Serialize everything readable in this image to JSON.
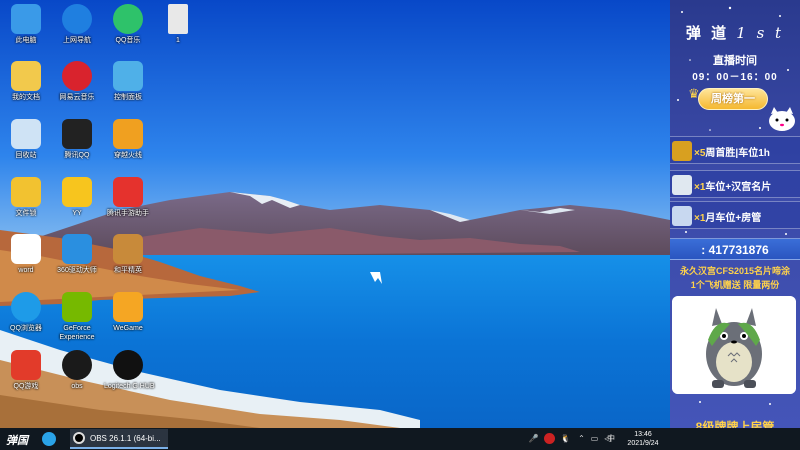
{
  "desktop": {
    "icons": [
      {
        "label": "此电脑",
        "icon": "computer-icon",
        "color": "#3a9ae8"
      },
      {
        "label": "上网导航",
        "icon": "ie-browser-icon",
        "color": "#1f7fe0"
      },
      {
        "label": "QQ音乐",
        "icon": "qq-music-icon",
        "color": "#2ec26a"
      },
      {
        "label": "1",
        "icon": "text-file-icon",
        "color": "#e8e8e8"
      },
      {
        "label": "我的文档",
        "icon": "documents-folder-icon",
        "color": "#f2c94c"
      },
      {
        "label": "网易云音乐",
        "icon": "netease-music-icon",
        "color": "#d9232d"
      },
      {
        "label": "控制面板",
        "icon": "control-panel-icon",
        "color": "#4fb0e8"
      },
      {
        "label": "回收站",
        "icon": "recycle-bin-icon",
        "color": "#cfe3f5"
      },
      {
        "label": "腾讯QQ",
        "icon": "qq-penguin-icon",
        "color": "#222222"
      },
      {
        "label": "穿越火线",
        "icon": "crossfire-game-icon",
        "color": "#f0a020"
      },
      {
        "label": "文件锁",
        "icon": "file-lock-icon",
        "color": "#f2c230"
      },
      {
        "label": "YY",
        "icon": "yy-voice-icon",
        "color": "#f7c51e"
      },
      {
        "label": "腾讯手游助手",
        "icon": "mobile-game-assistant-icon",
        "color": "#e5322d"
      },
      {
        "label": "word",
        "icon": "word-document-icon",
        "color": "#ffffff"
      },
      {
        "label": "360驱动大师",
        "icon": "driver-master-icon",
        "color": "#2a8fe0"
      },
      {
        "label": "和平精英",
        "icon": "peace-elite-game-icon",
        "color": "#c88a3a"
      },
      {
        "label": "QQ浏览器",
        "icon": "qq-browser-icon",
        "color": "#1e9be8"
      },
      {
        "label": "GeForce Experience",
        "icon": "geforce-icon",
        "color": "#76b900"
      },
      {
        "label": "WeGame",
        "icon": "wegame-icon",
        "color": "#f5a623"
      },
      {
        "label": "QQ游戏",
        "icon": "qq-game-icon",
        "color": "#e23b2a"
      },
      {
        "label": "obs",
        "icon": "obs-icon",
        "color": "#1a1a1a"
      },
      {
        "label": "Logitech G HUB",
        "icon": "logitech-ghub-icon",
        "color": "#111111"
      }
    ]
  },
  "taskbar": {
    "start_label": "弹国",
    "obs_window": "OBS 26.1.1 (64-bi...",
    "ime": "中",
    "time": "13:46",
    "date": "2021/9/24"
  },
  "panel": {
    "title": "弹 道",
    "title_suffix": "1 s t",
    "live_label": "直播时间",
    "live_time": "09：00－16：00",
    "weekly_rank": "周榜第一",
    "rewards": [
      {
        "mult": "×5",
        "text": "周首胜|车位1h",
        "icon": "gold-card-icon"
      },
      {
        "mult": "×1",
        "text": "车位+汉宫名片",
        "icon": "airplane-icon"
      },
      {
        "mult": "×1",
        "text": "月车位+房管",
        "icon": "rocket-icon"
      }
    ],
    "qq": ": 417731876",
    "ad_line1": "永久汉宫CFS2015名片啼涂",
    "ad_line2": "1个飞机赠送 限量两份",
    "bottom": "8级牌牌上房管"
  },
  "colors": {
    "panel_bg": "#3b4aa8",
    "accent_yellow": "#ffd24a",
    "taskbar_bg": "#101820"
  }
}
